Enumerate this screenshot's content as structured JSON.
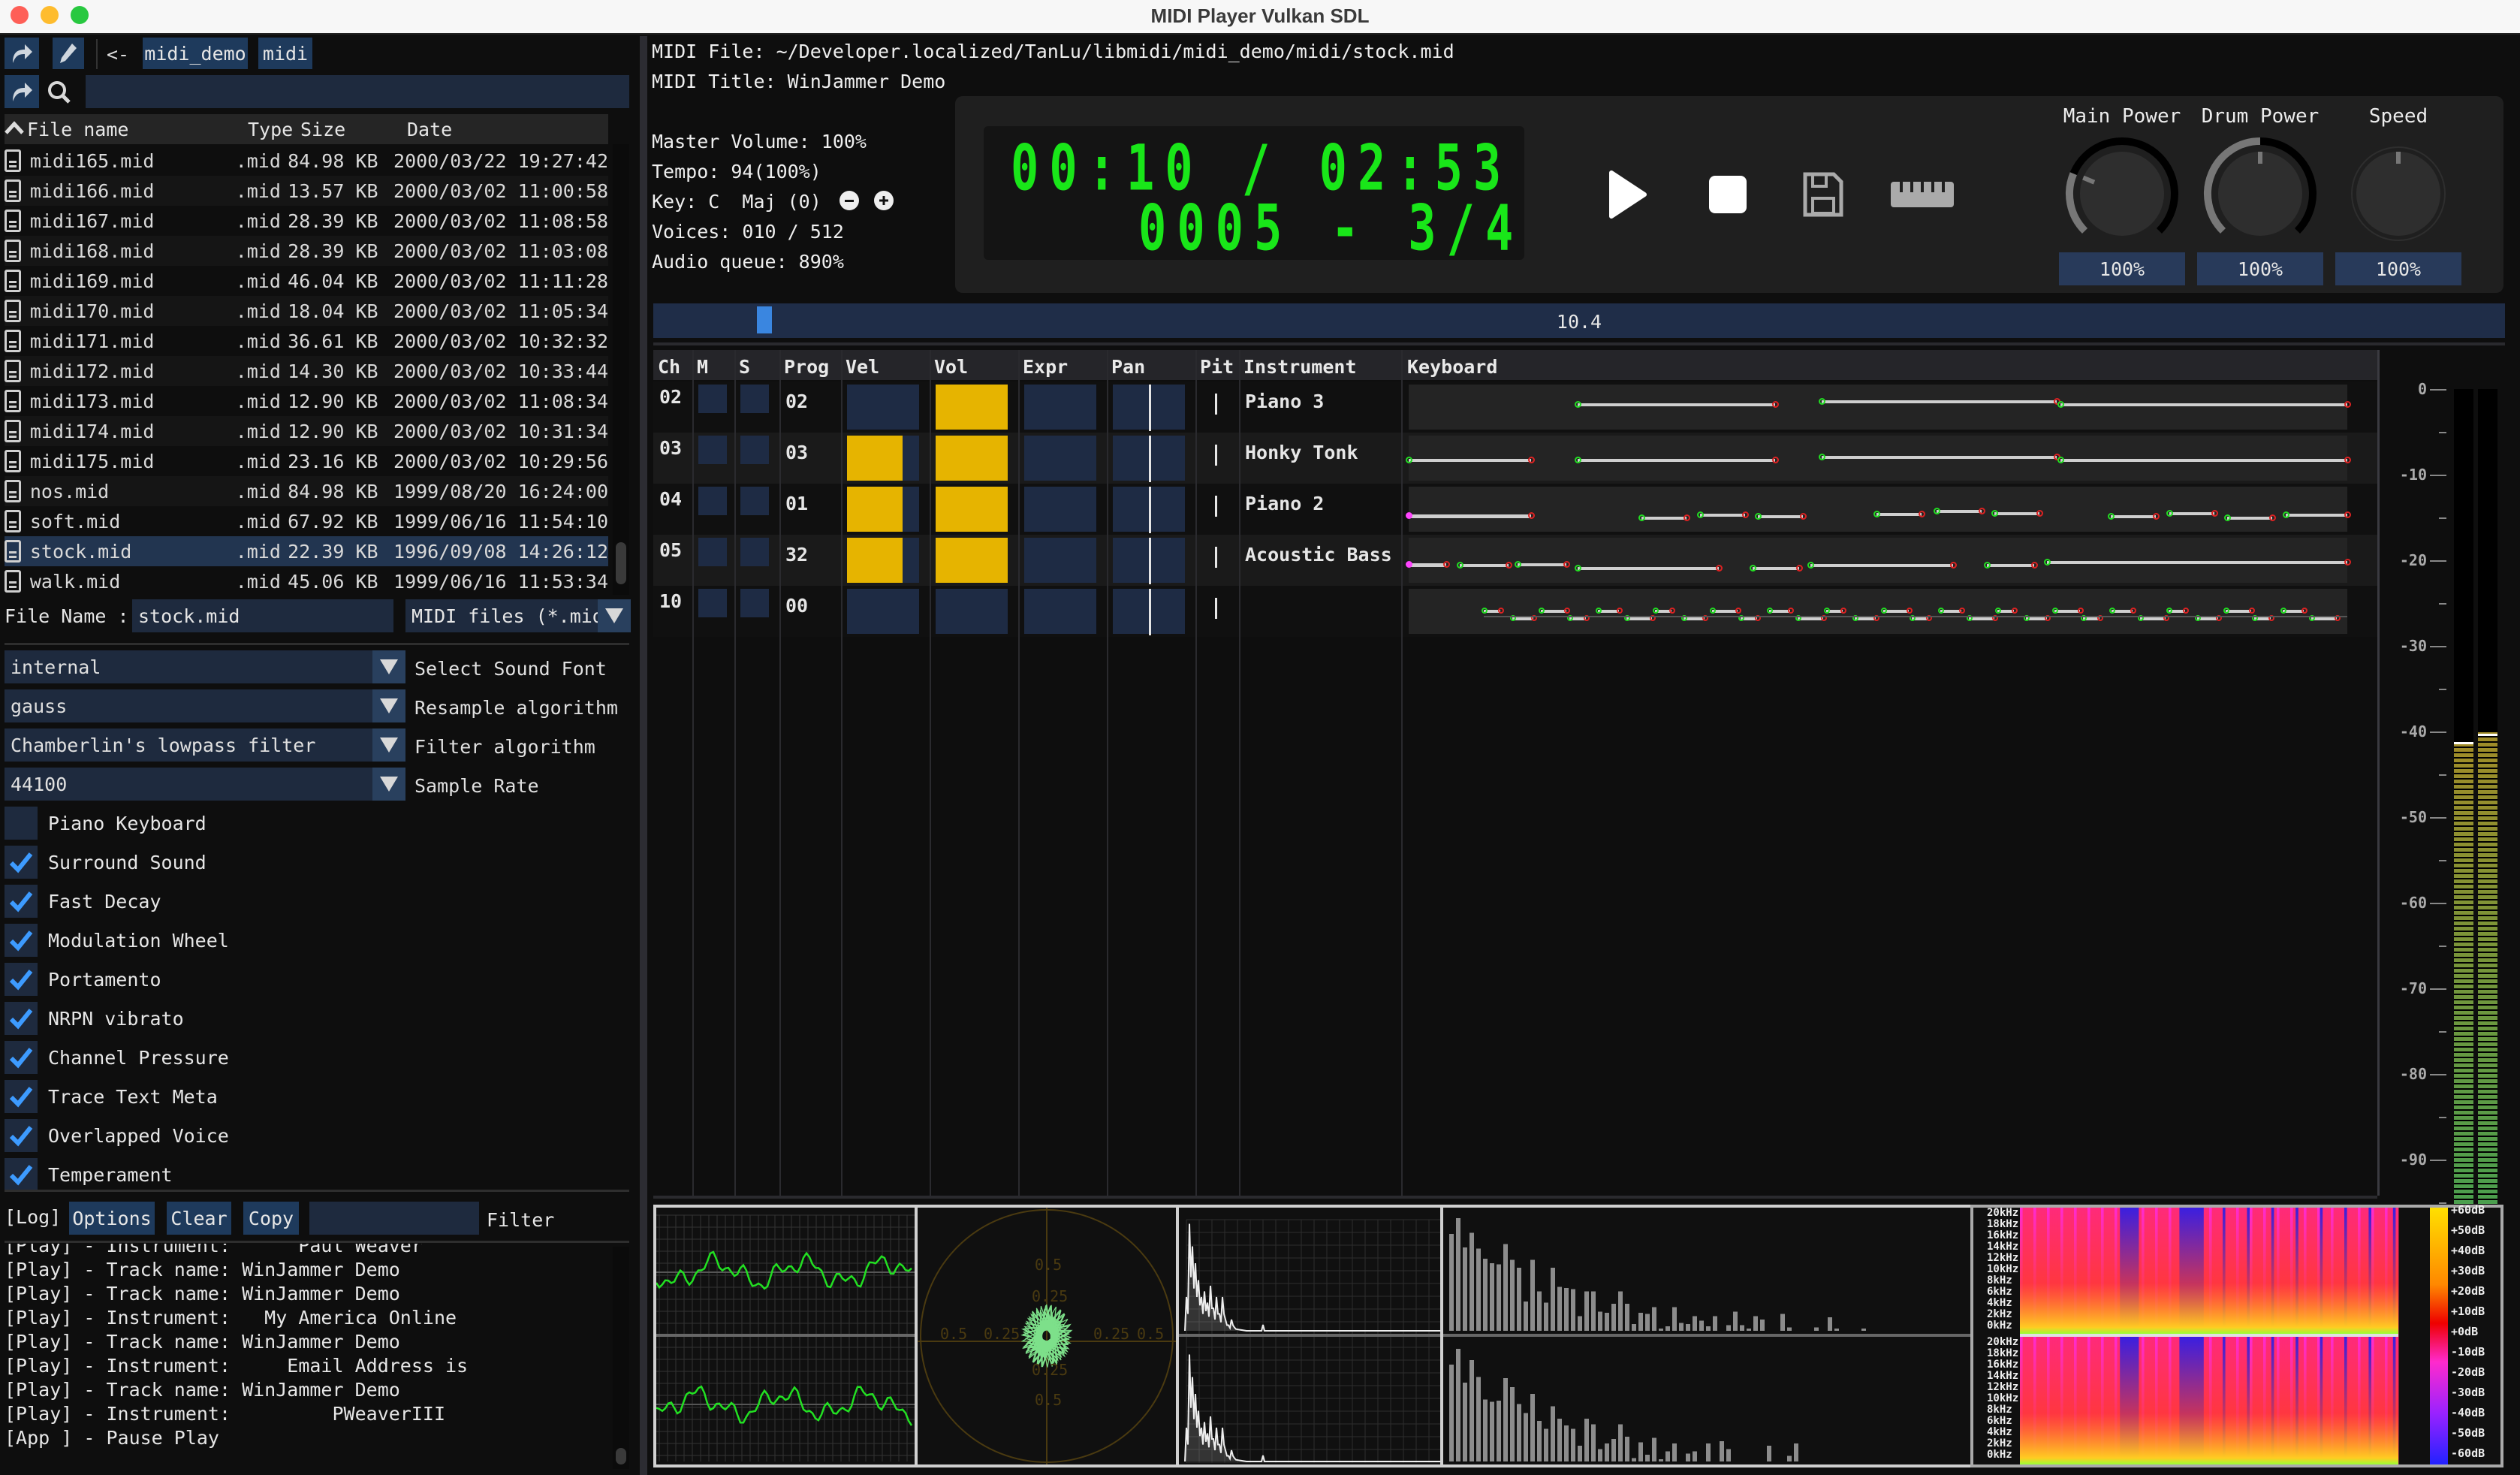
{
  "window": {
    "title": "MIDI Player Vulkan SDL"
  },
  "file_browser": {
    "path_back": "<-",
    "breadcrumbs": [
      "midi_demo",
      "midi"
    ],
    "search_value": "",
    "columns": [
      "File name",
      "Type",
      "Size",
      "Date"
    ],
    "files": [
      {
        "name": "midi165.mid",
        "type": ".mid",
        "size": "84.98 KB",
        "date": "2000/03/22 19:27:42"
      },
      {
        "name": "midi166.mid",
        "type": ".mid",
        "size": "13.57 KB",
        "date": "2000/03/02 11:00:58"
      },
      {
        "name": "midi167.mid",
        "type": ".mid",
        "size": "28.39 KB",
        "date": "2000/03/02 11:08:58"
      },
      {
        "name": "midi168.mid",
        "type": ".mid",
        "size": "28.39 KB",
        "date": "2000/03/02 11:03:08"
      },
      {
        "name": "midi169.mid",
        "type": ".mid",
        "size": "46.04 KB",
        "date": "2000/03/02 11:11:28"
      },
      {
        "name": "midi170.mid",
        "type": ".mid",
        "size": "18.04 KB",
        "date": "2000/03/02 11:05:34"
      },
      {
        "name": "midi171.mid",
        "type": ".mid",
        "size": "36.61 KB",
        "date": "2000/03/02 10:32:32"
      },
      {
        "name": "midi172.mid",
        "type": ".mid",
        "size": "14.30 KB",
        "date": "2000/03/02 10:33:44"
      },
      {
        "name": "midi173.mid",
        "type": ".mid",
        "size": "12.90 KB",
        "date": "2000/03/02 11:08:34"
      },
      {
        "name": "midi174.mid",
        "type": ".mid",
        "size": "12.90 KB",
        "date": "2000/03/02 10:31:34"
      },
      {
        "name": "midi175.mid",
        "type": ".mid",
        "size": "23.16 KB",
        "date": "2000/03/02 10:29:56"
      },
      {
        "name": "nos.mid",
        "type": ".mid",
        "size": "84.98 KB",
        "date": "1999/08/20 16:24:00"
      },
      {
        "name": "soft.mid",
        "type": ".mid",
        "size": "67.92 KB",
        "date": "1999/06/16 11:54:10"
      },
      {
        "name": "stock.mid",
        "type": ".mid",
        "size": "22.39 KB",
        "date": "1996/09/08 14:26:12",
        "selected": true
      },
      {
        "name": "walk.mid",
        "type": ".mid",
        "size": "45.06 KB",
        "date": "1999/06/16 11:53:34"
      }
    ],
    "file_name_label": "File Name :",
    "file_name_value": "stock.mid",
    "filter_value": "MIDI files (*.mid"
  },
  "settings": {
    "combos": [
      {
        "value": "internal",
        "label": "Select Sound Font"
      },
      {
        "value": "gauss",
        "label": "Resample algorithm"
      },
      {
        "value": "Chamberlin's lowpass filter",
        "label": "Filter algorithm"
      },
      {
        "value": "44100",
        "label": "Sample Rate"
      }
    ],
    "checkboxes": [
      {
        "label": "Piano Keyboard",
        "checked": false
      },
      {
        "label": "Surround Sound",
        "checked": true
      },
      {
        "label": "Fast Decay",
        "checked": true
      },
      {
        "label": "Modulation Wheel",
        "checked": true
      },
      {
        "label": "Portamento",
        "checked": true
      },
      {
        "label": "NRPN vibrato",
        "checked": true
      },
      {
        "label": "Channel Pressure",
        "checked": true
      },
      {
        "label": "Trace Text Meta",
        "checked": true
      },
      {
        "label": "Overlapped Voice",
        "checked": true
      },
      {
        "label": "Temperament",
        "checked": true
      }
    ]
  },
  "log": {
    "title": "[Log]",
    "options_label": "Options",
    "clear_label": "Clear",
    "copy_label": "Copy",
    "filter_value": "",
    "filter_label": "Filter",
    "lines": [
      "[Play] - Instrument:      Paul Weaver",
      "[Play] - Track name: WinJammer Demo",
      "[Play] - Track name: WinJammer Demo",
      "[Play] - Instrument:   My America Online",
      "[Play] - Track name: WinJammer Demo",
      "[Play] - Instrument:     Email Address is",
      "[Play] - Track name: WinJammer Demo",
      "[Play] - Instrument:         PWeaverIII",
      "[App ] - Pause Play"
    ]
  },
  "player": {
    "midi_file": "MIDI File: ~/Developer.localized/TanLu/libmidi/midi_demo/midi/stock.mid",
    "midi_title": "MIDI Title: WinJammer Demo",
    "master_volume": "Master Volume: 100%",
    "tempo": "Tempo: 94(100%)",
    "key": "Key: C  Maj (0)",
    "voices": "Voices: 010 / 512",
    "audio_queue": "Audio queue: 890%",
    "time_display": "00:10 / 02:53",
    "bar_display": "0005 - 3/4",
    "knobs": [
      {
        "label": "Main Power",
        "value": "100%",
        "level": 0.25
      },
      {
        "label": "Drum Power",
        "value": "100%",
        "level": 0.5
      },
      {
        "label": "Speed",
        "value": "100%",
        "level": 0.5
      }
    ],
    "position_value": "10.4",
    "position_fraction": 0.06
  },
  "channels": {
    "columns": [
      "Ch",
      "M",
      "S",
      "Prog",
      "Vel",
      "Vol",
      "Expr",
      "Pan",
      "Pit",
      "Instrument",
      "Keyboard"
    ],
    "rows": [
      {
        "ch": "02",
        "prog": "02",
        "vel": 0.0,
        "vol": 1.0,
        "instrument": "Piano 3"
      },
      {
        "ch": "03",
        "prog": "03",
        "vel": 0.77,
        "vol": 1.0,
        "instrument": "Honky Tonk"
      },
      {
        "ch": "04",
        "prog": "01",
        "vel": 0.77,
        "vol": 1.0,
        "instrument": "Piano 2"
      },
      {
        "ch": "05",
        "prog": "32",
        "vel": 0.77,
        "vol": 1.0,
        "instrument": "Acoustic Bass"
      },
      {
        "ch": "10",
        "prog": "00",
        "vel": 0.0,
        "vol": 0.0,
        "instrument": ""
      }
    ]
  },
  "vu_meter": {
    "ticks": [
      "0",
      "-10",
      "-20",
      "-30",
      "-40",
      "-50",
      "-60",
      "-70",
      "-80",
      "-90"
    ],
    "left_db": -41.5,
    "right_db": -40.5
  },
  "analyzers": {
    "vectorscope_labels": [
      "0.5",
      "0.25",
      "0.25",
      "0.5",
      "0.5",
      "0.25",
      "0.25",
      "0.5"
    ],
    "spectrogram_freq_labels": [
      "20kHz",
      "18kHz",
      "16kHz",
      "14kHz",
      "12kHz",
      "10kHz",
      "8kHz",
      "6kHz",
      "4kHz",
      "2kHz",
      "0kHz"
    ],
    "spectrogram_db_labels": [
      "+60dB",
      "+50dB",
      "+40dB",
      "+30dB",
      "+20dB",
      "+10dB",
      "+0dB",
      "-10dB",
      "-20dB",
      "-30dB",
      "-40dB",
      "-50dB",
      "-60dB"
    ]
  },
  "colors": {
    "accent_blue": "#3a86e0",
    "lcd_green": "#19e619",
    "bar_yellow": "#e6b400",
    "note_on": "#22dd22",
    "note_off": "#dd2222",
    "note_active": "#ff44ff"
  }
}
